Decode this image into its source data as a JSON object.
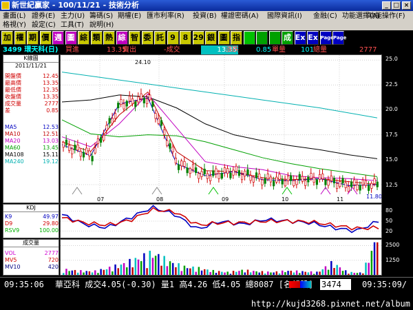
{
  "window": {
    "title": "新世紀贏家 - 100/11/21 - 技術分析"
  },
  "menu": {
    "row1": [
      "畫面(L)",
      "證券(E)",
      "主力(U)",
      "籌碼(S)",
      "期權(E)",
      "匯市利率(R)",
      "投資(B)",
      "權證密碼(A)",
      "國際資訊(I)",
      "金融(C)",
      "功能選擇(A)",
      "功能操作(F)"
    ],
    "row2": [
      "格視(Y)",
      "設定(C)",
      "工具(T)",
      "說明(H)"
    ]
  },
  "toolbar": {
    "buttons": [
      "加",
      "權",
      "期",
      "價",
      "週",
      "圖",
      "綜",
      "類",
      "熱",
      "綜",
      "智",
      "委",
      "託",
      "9",
      "8",
      "29",
      "銀",
      "圖",
      "指",
      "",
      "",
      "",
      "成",
      "Ex",
      "Ex",
      "Page",
      "Page"
    ],
    "colors": [
      "#c8c800",
      "#c8c800",
      "#c8c800",
      "#c8c800",
      "#c000c0",
      "#c000c0",
      "#c8c800",
      "#c8c800",
      "#c8c800",
      "#c000c0",
      "#c8c800",
      "#c8c800",
      "#c8c800",
      "#c8c800",
      "#c8c800",
      "#c8c800",
      "#c8c800",
      "#c8c800",
      "#c8c800",
      "#00c000",
      "#00a000",
      "#00a000",
      "#00a000",
      "#0000c0",
      "#0000c0",
      "#0000c0",
      "#0000c0"
    ]
  },
  "quote": {
    "stock": "3499 環天科(日)",
    "bid_label": "買進",
    "bid": "13.35",
    "ask_label": "賣出",
    "change_label": "-成交",
    "last": "13.35",
    "change_label2": "漲跌",
    "change": "0.85",
    "unit_label": "單量",
    "unit": "101",
    "volume_label": "總量",
    "volume": "2777"
  },
  "kpanel": {
    "title": "K線圖",
    "date": "2011/11/21",
    "rows": [
      {
        "label": "開盤價",
        "value": "12.45",
        "color": "#d00000"
      },
      {
        "label": "最高價",
        "value": "13.35",
        "color": "#d00000"
      },
      {
        "label": "最低價",
        "value": "12.35",
        "color": "#d00000"
      },
      {
        "label": "收盤價",
        "value": "13.35",
        "color": "#d00000"
      },
      {
        "label": "成交量",
        "value": "2777",
        "color": "#d00000"
      },
      {
        "label": "差",
        "value": "0.85",
        "color": "#d00000"
      }
    ],
    "ma": [
      {
        "label": "MA5",
        "value": "12.53",
        "color": "#0000c0"
      },
      {
        "label": "MA10",
        "value": "12.51",
        "color": "#c00000"
      },
      {
        "label": "MA20",
        "value": "13.03",
        "color": "#c000c0"
      },
      {
        "label": "MA60",
        "value": "13.45",
        "color": "#00a000"
      },
      {
        "label": "MA108",
        "value": "15.11",
        "color": "#000000"
      },
      {
        "label": "MA240",
        "value": "19.12",
        "color": "#00b0b0"
      }
    ]
  },
  "kd_panel": {
    "title": "KDJ",
    "rows": [
      {
        "label": "K9",
        "value": "49.97",
        "color": "#0000c0"
      },
      {
        "label": "D9",
        "value": "29.80",
        "color": "#d00000"
      },
      {
        "label": "RSV9",
        "value": "100.00",
        "color": "#00b000"
      }
    ]
  },
  "vol_panel": {
    "title": "成交量",
    "rows": [
      {
        "label": "VOL",
        "value": "2777",
        "color": "#d000d0"
      },
      {
        "label": "MV5",
        "value": "720",
        "color": "#d00000"
      },
      {
        "label": "MV10",
        "value": "420",
        "color": "#000080"
      }
    ]
  },
  "chart_data": [
    {
      "type": "candlestick",
      "x_ticks": [
        "07",
        "08",
        "09",
        "10",
        "11"
      ],
      "y_ticks": [
        "25.0",
        "22.5",
        "20.0",
        "17.5",
        "15.0",
        "12.5"
      ],
      "ylim": [
        10.7,
        25.5
      ],
      "annotations": [
        "24.10",
        "11.80"
      ],
      "series": [
        {
          "name": "MA240",
          "color": "#00b0b0",
          "values": [
            23.8,
            23.4,
            23.0,
            22.6,
            22.2,
            21.8,
            21.4,
            21.0,
            20.6,
            20.2,
            19.7,
            19.2
          ]
        },
        {
          "name": "MA108",
          "color": "#000000",
          "values": [
            20.8,
            21.0,
            21.5,
            21.3,
            20.2,
            18.6,
            17.5,
            16.9,
            16.4,
            16.0,
            15.5,
            15.1
          ]
        },
        {
          "name": "MA60",
          "color": "#00a000",
          "values": [
            19.0,
            17.6,
            17.3,
            17.5,
            17.4,
            16.8,
            16.0,
            15.2,
            14.6,
            14.1,
            13.7,
            13.3
          ]
        },
        {
          "name": "MA20",
          "color": "#c000c0",
          "values": [
            17.3,
            16.3,
            18.6,
            21.6,
            18.2,
            14.8,
            14.3,
            14.0,
            13.4,
            13.2,
            13.1,
            12.9
          ]
        },
        {
          "name": "MA10",
          "color": "#c00000",
          "values": [
            16.8,
            15.8,
            19.5,
            21.8,
            15.8,
            13.9,
            13.8,
            13.2,
            13.0,
            13.1,
            12.8,
            12.5
          ]
        },
        {
          "name": "MA5",
          "color": "#0000c0",
          "values": [
            16.5,
            15.4,
            20.6,
            21.2,
            14.6,
            13.4,
            13.8,
            13.0,
            12.9,
            13.1,
            12.4,
            12.5
          ]
        }
      ]
    },
    {
      "type": "line",
      "x_ticks": [
        "07",
        "08",
        "09",
        "10",
        "11"
      ],
      "y_ticks": [
        "80",
        "50",
        "20"
      ],
      "ylim": [
        0,
        100
      ],
      "series": [
        {
          "name": "K9",
          "color": "#0000c0",
          "values": [
            70,
            40,
            30,
            60,
            92,
            70,
            25,
            50,
            40,
            55,
            50,
            45,
            30,
            20,
            50
          ]
        },
        {
          "name": "D9",
          "color": "#d00000",
          "values": [
            60,
            45,
            38,
            52,
            85,
            78,
            38,
            45,
            45,
            50,
            50,
            48,
            38,
            28,
            30
          ]
        }
      ]
    },
    {
      "type": "bar",
      "y_ticks": [
        "2500",
        "1250"
      ],
      "ylim": [
        0,
        3000
      ],
      "series": [
        {
          "name": "VOL",
          "values": [
            400,
            300,
            250,
            500,
            800,
            1200,
            1600,
            1000,
            600,
            500,
            300,
            200,
            350,
            250,
            200,
            300,
            250,
            200,
            900,
            200,
            150,
            2777
          ]
        },
        {
          "name": "MV5",
          "color": "#d00000",
          "values": []
        },
        {
          "name": "MV10",
          "color": "#000080",
          "values": []
        }
      ]
    }
  ],
  "status": {
    "time": "09:35:06",
    "text": "華亞科 成交4.05(-0.30) 量1 高4.26 低4.05 總8087 [名望股]",
    "code": "3474",
    "time2": "09:35:09/"
  },
  "url": "http://kujd3268.pixnet.net/album"
}
